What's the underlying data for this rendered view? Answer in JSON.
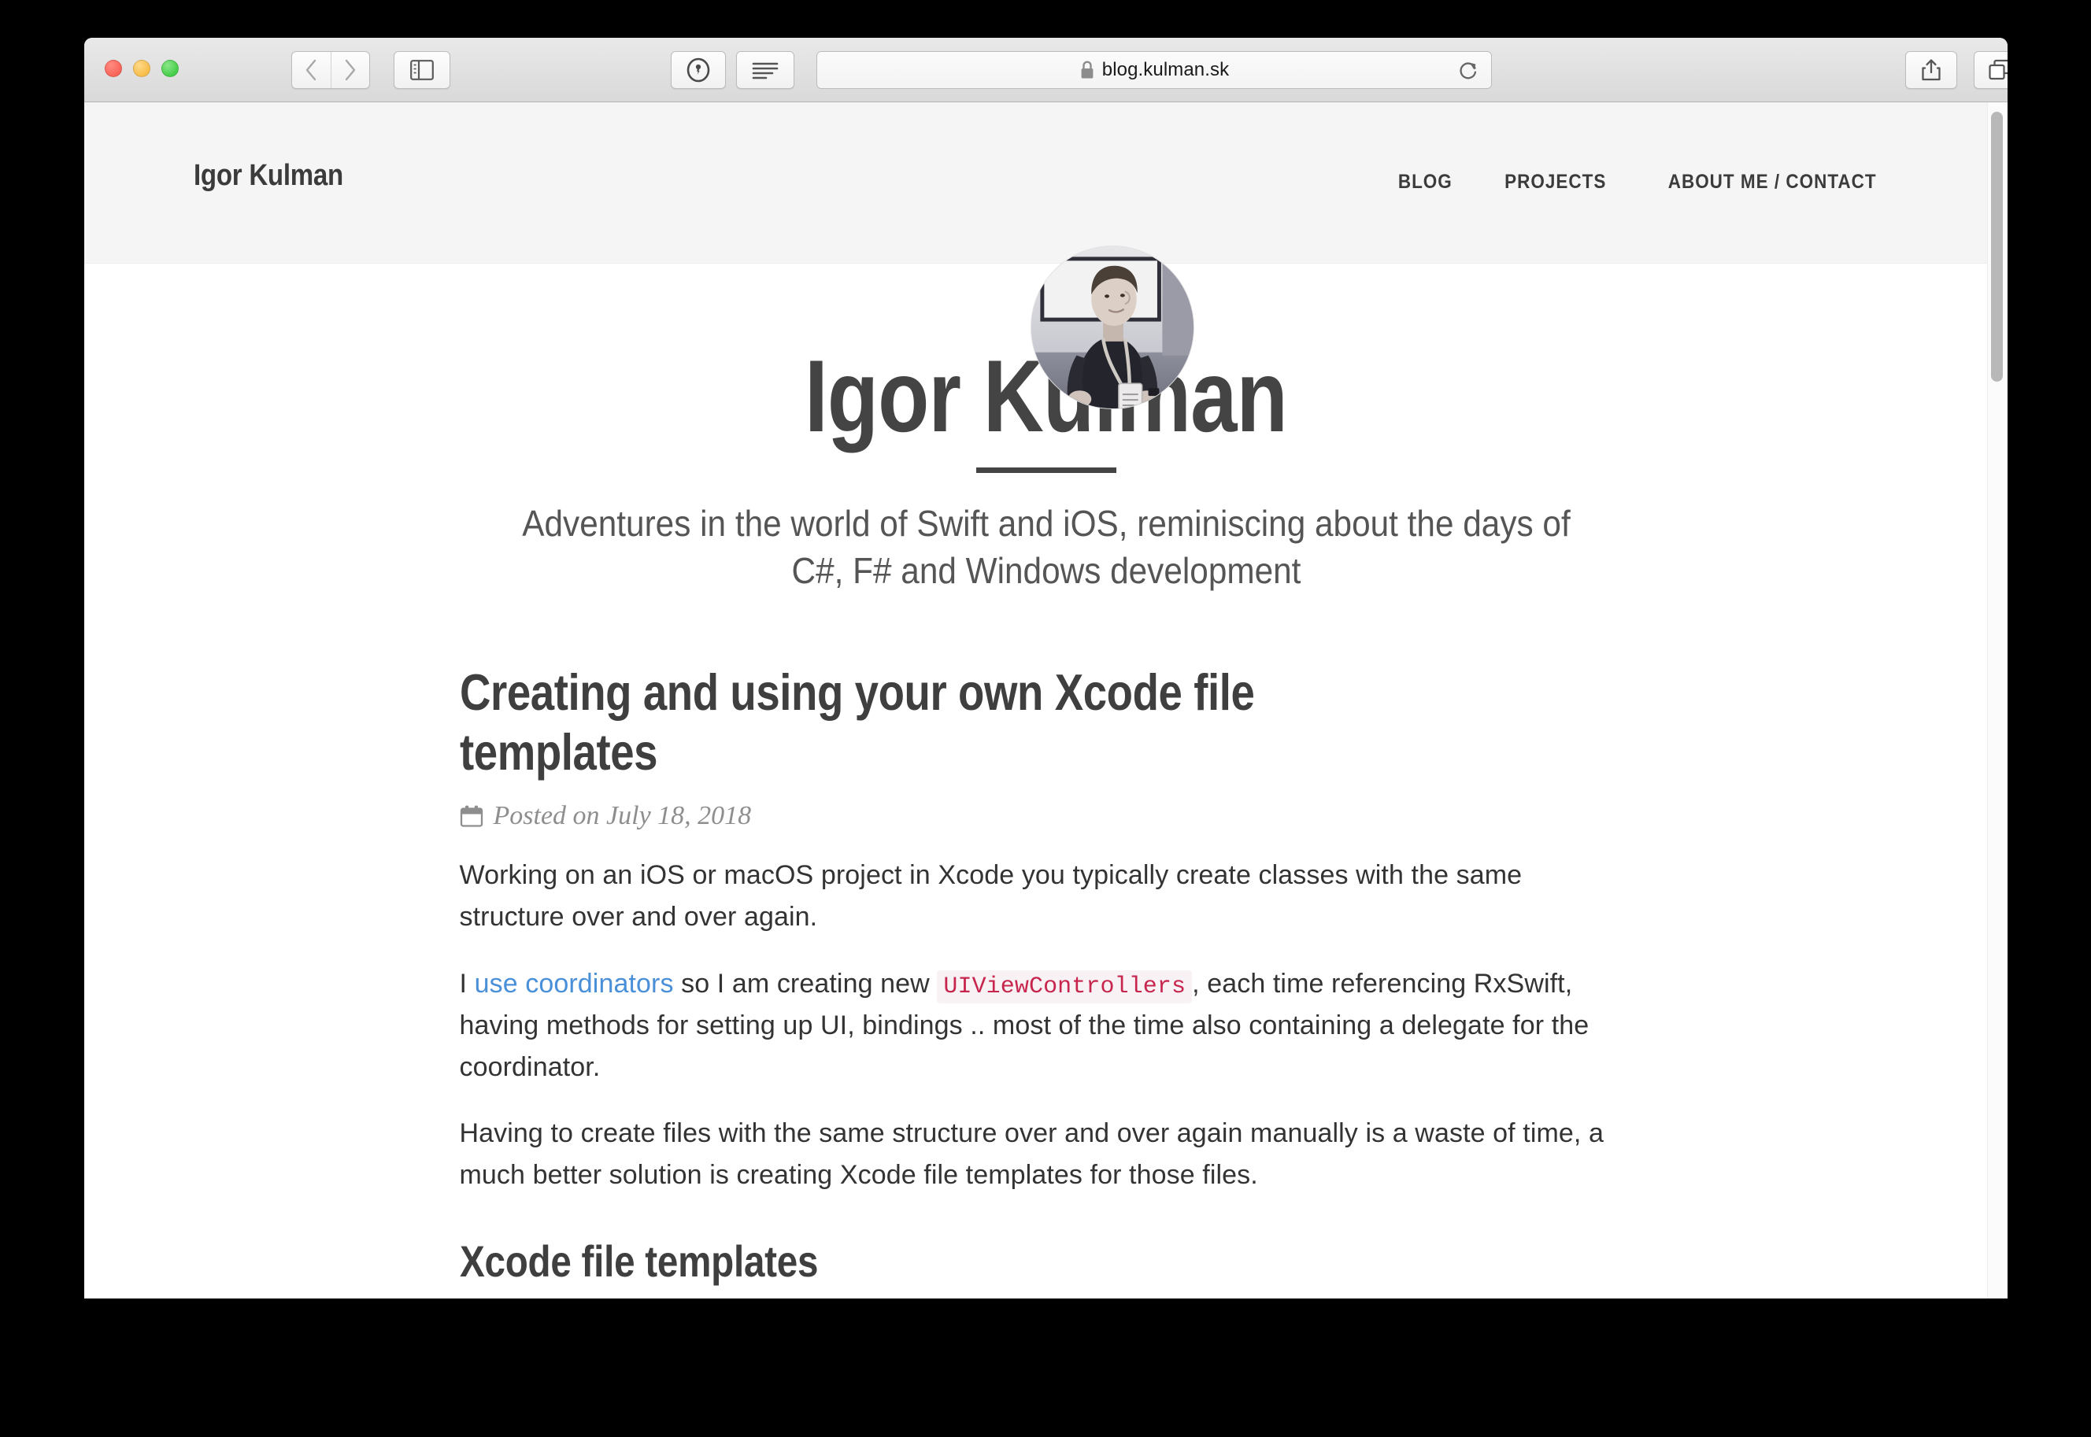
{
  "browser": {
    "url": "blog.kulman.sk",
    "lock_icon": "lock-icon",
    "reload_icon": "reload-icon",
    "back_icon": "chevron-left-icon",
    "forward_icon": "chevron-right-icon",
    "sidebar_icon": "sidebar-icon",
    "password_icon": "onepassword-key-icon",
    "reader_icon": "reader-view-icon",
    "share_icon": "share-icon",
    "tabs_icon": "tab-overview-icon",
    "new_tab_label": "+"
  },
  "site": {
    "brand": "Igor Kulman",
    "nav": [
      {
        "label": "BLOG"
      },
      {
        "label": "PROJECTS"
      },
      {
        "label": "ABOUT ME / CONTACT"
      }
    ],
    "avatar_alt": "avatar-photo"
  },
  "hero": {
    "title": "Igor Kulman",
    "tagline": "Adventures in the world of Swift and iOS, reminiscing about the days of C#, F# and Windows development"
  },
  "article": {
    "title": "Creating and using your own Xcode file templates",
    "meta_prefix": "Posted on",
    "date": "July 18, 2018",
    "calendar_icon": "calendar-icon",
    "p1": "Working on an iOS or macOS project in Xcode you typically create classes with the same structure over and over again.",
    "p2_pre": "I ",
    "p2_link": "use coordinators",
    "p2_mid": " so I am creating new ",
    "p2_code": "UIViewControllers",
    "p2_post": ", each time referencing RxSwift, having methods for setting up UI, bindings .. most of the time also containing a delegate for the coordinator.",
    "p3": "Having to create files with the same structure over and over again manually is a waste of time, a much better solution is creating Xcode file templates for those files.",
    "section_heading": "Xcode file templates"
  },
  "colors": {
    "link": "#4a90d9",
    "code_text": "#c7254e",
    "code_bg": "#f9f2f4",
    "heading": "#3f3f3f",
    "header_bg": "#f5f5f5"
  }
}
